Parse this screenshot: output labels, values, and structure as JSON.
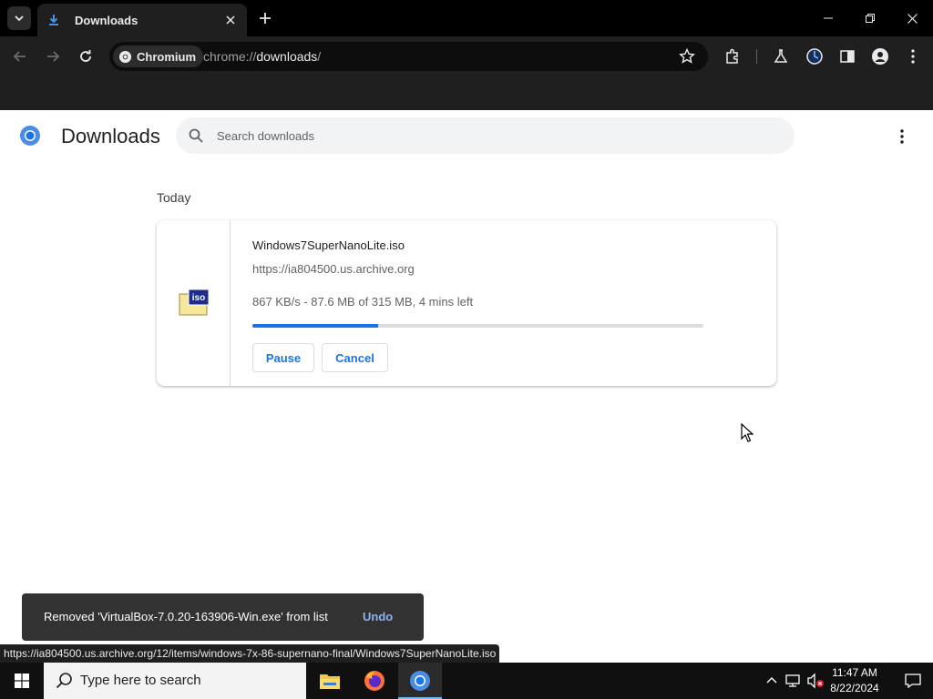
{
  "tabs": [
    {
      "title": "Downloads"
    }
  ],
  "omnibox": {
    "site_chip": "Chromium",
    "url_scheme": "chrome://",
    "url_host": "downloads",
    "url_path": "/"
  },
  "page": {
    "title": "Downloads",
    "search_placeholder": "Search downloads"
  },
  "downloads": {
    "section": "Today",
    "items": [
      {
        "file_name": "Windows7SuperNanoLite.iso",
        "icon_label": "iso",
        "source": "https://ia804500.us.archive.org",
        "status": "867 KB/s - 87.6 MB of 315 MB, 4 mins left",
        "progress": 0.278,
        "pause_label": "Pause",
        "cancel_label": "Cancel"
      }
    ]
  },
  "toast": {
    "message": "Removed 'VirtualBox-7.0.20-163906-Win.exe' from list",
    "undo_label": "Undo"
  },
  "status_bubble": "https://ia804500.us.archive.org/12/items/windows-7x-86-supernano-final/Windows7SuperNanoLite.iso",
  "taskbar": {
    "search_placeholder": "Type here to search",
    "time": "11:47 AM",
    "date": "8/22/2024"
  },
  "colors": {
    "accent": "#1a73e8",
    "toast_bg": "#323232",
    "toast_link": "#8ab4f8"
  }
}
